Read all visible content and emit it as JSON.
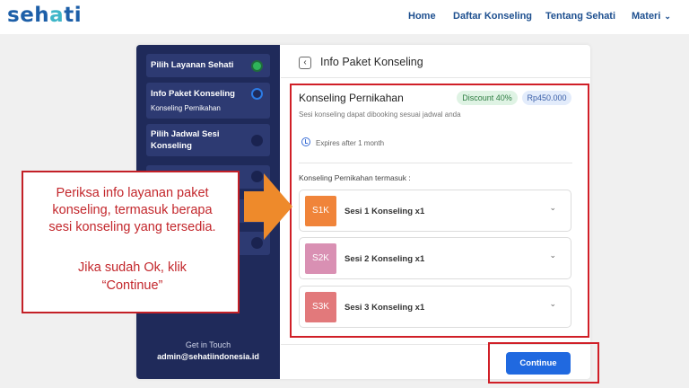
{
  "app": {
    "logo_main": "seh",
    "logo_accent": "a",
    "logo_end": "ti"
  },
  "nav": {
    "home": "Home",
    "daftar": "Daftar Konseling",
    "tentang": "Tentang Sehati",
    "materi": "Materi",
    "materi_chevron": "⌄"
  },
  "sidebar": {
    "steps": [
      {
        "title": "Pilih Layanan Sehati",
        "subtitle": "",
        "status": "done"
      },
      {
        "title": "Info Paket Konseling",
        "subtitle": "Konseling Pernikahan",
        "status": "active"
      },
      {
        "title": "Pilih Jadwal Sesi",
        "title2": "Konseling",
        "subtitle": "",
        "status": "todo"
      }
    ],
    "get_in_touch": "Get in Touch",
    "email": "admin@sehatiindonesia.id"
  },
  "content": {
    "back_icon": "‹",
    "title": "Info Paket Konseling",
    "package_name": "Konseling Pernikahan",
    "discount": "Discount 40%",
    "price": "Rp450.000",
    "description": "Sesi konseling dapat dibooking sesuai jadwal anda",
    "expires": "Expires after 1 month",
    "includes_label": "Konseling Pernikahan termasuk :",
    "sessions": [
      {
        "code": "S1K",
        "name": "Sesi 1 Konseling x1",
        "color": "#f0843a"
      },
      {
        "code": "S2K",
        "name": "Sesi 2 Konseling x1",
        "color": "#d990b3"
      },
      {
        "code": "S3K",
        "name": "Sesi 3 Konseling x1",
        "color": "#e2797b"
      }
    ],
    "chevron": "⌄",
    "continue": "Continue"
  },
  "callout": {
    "line1": "Periksa info layanan paket",
    "line2": "konseling, termasuk berapa",
    "line3": "sesi konseling yang tersedia.",
    "line4": "Jika sudah Ok, klik",
    "line5": "“Continue”"
  },
  "colors": {
    "sidebar_bg": "#1f2a5a",
    "primary": "#2069e0",
    "highlight_red": "#d01f27",
    "arrow_orange": "#ee8a2b"
  }
}
